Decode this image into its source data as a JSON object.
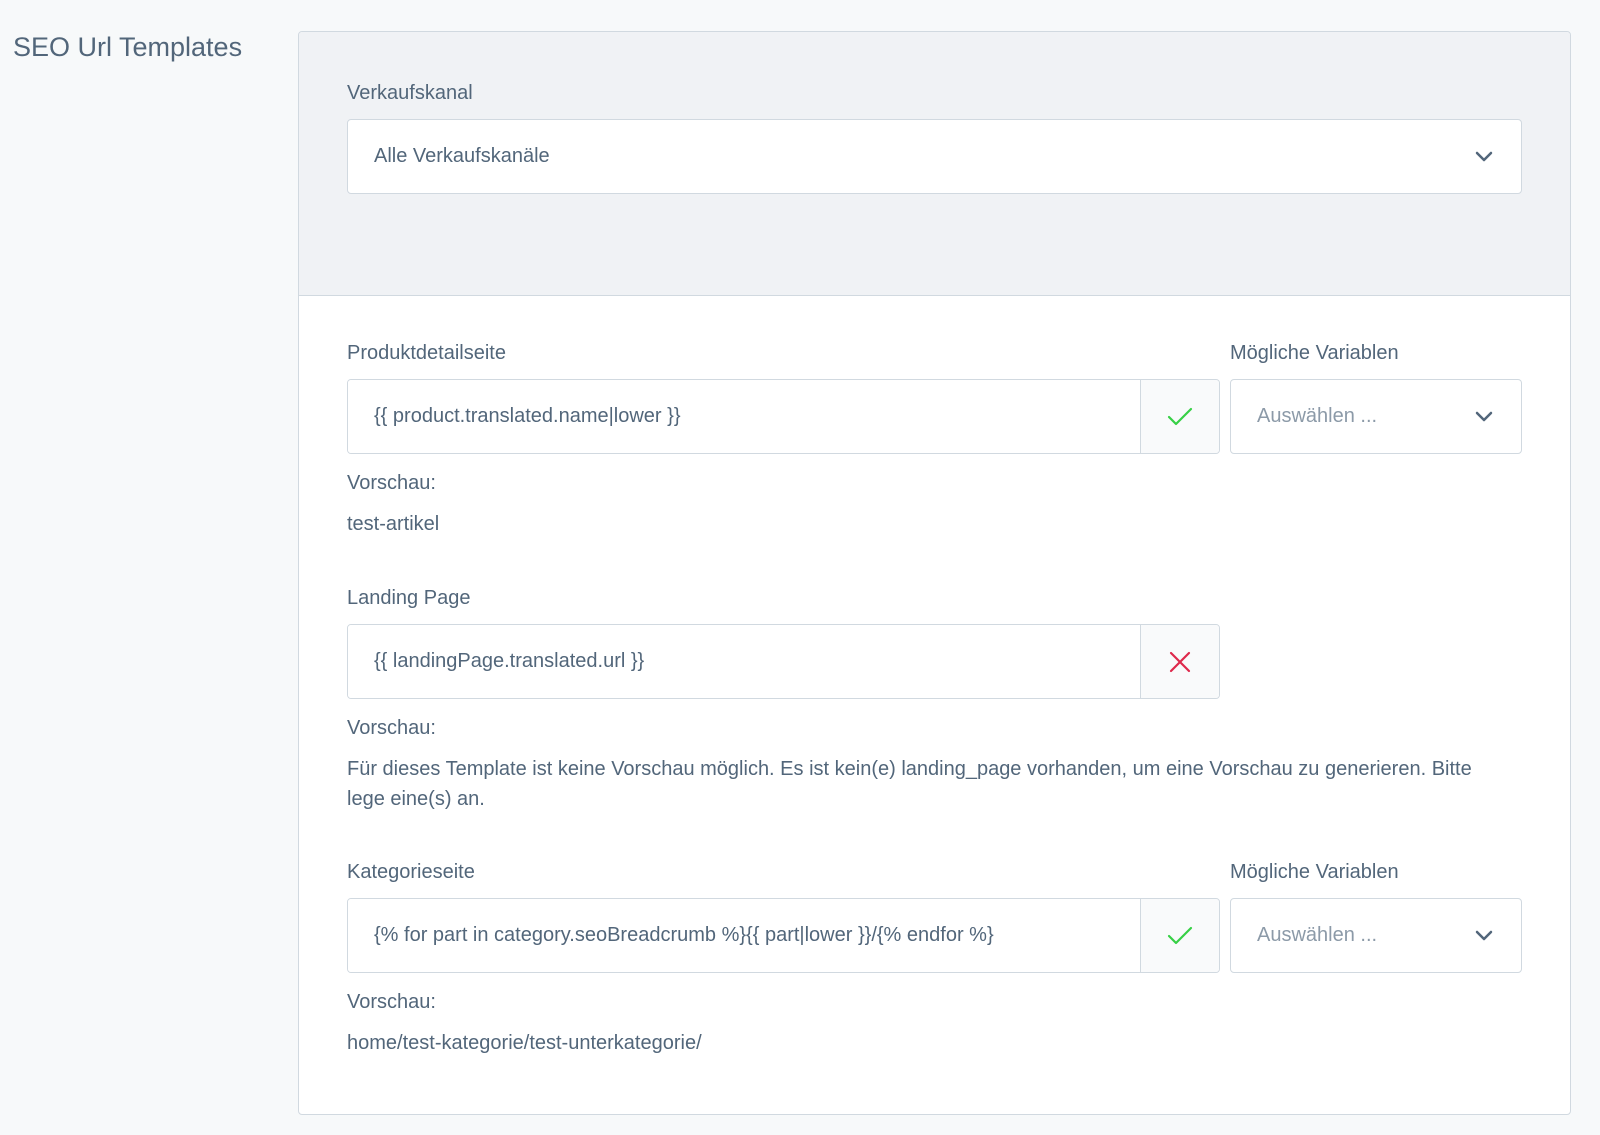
{
  "page": {
    "title": "SEO Url Templates"
  },
  "sales_channel": {
    "label": "Verkaufskanal",
    "selected": "Alle Verkaufskanäle"
  },
  "templates": [
    {
      "label": "Produktdetailseite",
      "value": "{{ product.translated.name|lower }}",
      "status": "valid",
      "variables_label": "Mögliche Variablen",
      "variables_placeholder": "Auswählen ...",
      "preview_label": "Vorschau:",
      "preview_value": "test-artikel"
    },
    {
      "label": "Landing Page",
      "value": "{{ landingPage.translated.url }}",
      "status": "invalid",
      "preview_label": "Vorschau:",
      "preview_value": "Für dieses Template ist keine Vorschau möglich. Es ist kein(e) landing_page vorhanden, um eine Vorschau zu generieren. Bitte lege eine(s) an."
    },
    {
      "label": "Kategorieseite",
      "value": "{% for part in category.seoBreadcrumb %}{{ part|lower }}/{% endfor %}",
      "status": "valid",
      "variables_label": "Mögliche Variablen",
      "variables_placeholder": "Auswählen ...",
      "preview_label": "Vorschau:",
      "preview_value": "home/test-kategorie/test-unterkategorie/"
    }
  ],
  "icons": {
    "valid": "checkmark-icon",
    "invalid": "x-icon",
    "dropdown": "chevron-down-icon"
  },
  "colors": {
    "valid": "#37d046",
    "invalid": "#de294c",
    "text": "#52667a",
    "border": "#d1d9e0",
    "header_bg": "#f0f2f5",
    "page_bg": "#f7f9fa"
  }
}
